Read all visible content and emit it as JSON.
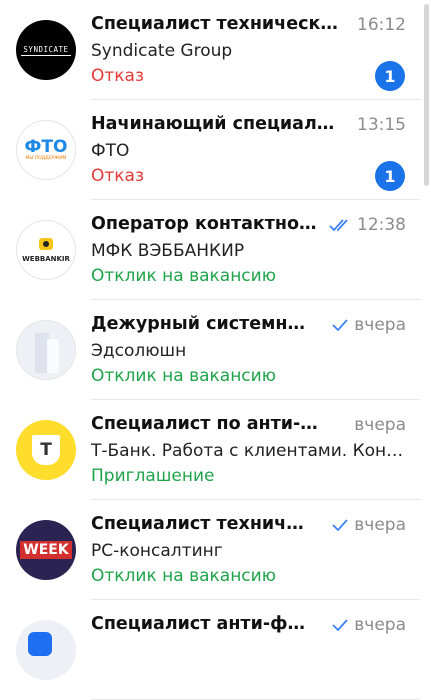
{
  "colors": {
    "reject": "#e53935",
    "response": "#1fa34a",
    "invite": "#1fa34a",
    "badge": "#1a73e8",
    "check": "#3b82f6"
  },
  "chats": [
    {
      "title": "Специалист техническ…",
      "time": "16:12",
      "company": "Syndicate Group",
      "status": "Отказ",
      "status_kind": "reject",
      "unread": "1",
      "check": "",
      "avatar": {
        "kind": "syndicate",
        "text": "SYNDICATE"
      }
    },
    {
      "title": "Начинающий специал…",
      "time": "13:15",
      "company": "ФТО",
      "status": "Отказ",
      "status_kind": "reject",
      "unread": "1",
      "check": "",
      "avatar": {
        "kind": "fto",
        "text": "ФТО",
        "subtext": "МЫ ПОДДЕРЖИМ"
      }
    },
    {
      "title": "Оператор контактно…",
      "time": "12:38",
      "company": "МФК ВЭББАНКИР",
      "status": "Отклик на вакансию",
      "status_kind": "response",
      "unread": "",
      "check": "double-check-icon",
      "avatar": {
        "kind": "webbankir",
        "text": "WEBBANKIR"
      }
    },
    {
      "title": "Дежурный системн…",
      "time": "вчера",
      "company": "Эдсолюшн",
      "status": "Отклик на вакансию",
      "status_kind": "response",
      "unread": "",
      "check": "check-icon",
      "avatar": {
        "kind": "building",
        "text": ""
      }
    },
    {
      "title": "Специалист по анти-…",
      "time": "вчера",
      "company": "Т-Банк. Работа с клиентами. Кон…",
      "status": "Приглашение",
      "status_kind": "invite",
      "unread": "",
      "check": "",
      "avatar": {
        "kind": "tbank",
        "text": "Т"
      }
    },
    {
      "title": "Специалист технич…",
      "time": "вчера",
      "company": "РС-консалтинг",
      "status": "Отклик на вакансию",
      "status_kind": "response",
      "unread": "",
      "check": "check-icon",
      "avatar": {
        "kind": "week",
        "text": "WEEK"
      }
    },
    {
      "title": "Специалист анти-ф…",
      "time": "вчера",
      "company": "",
      "status": "",
      "status_kind": "response",
      "unread": "",
      "check": "check-icon",
      "avatar": {
        "kind": "blue",
        "text": ""
      }
    }
  ]
}
